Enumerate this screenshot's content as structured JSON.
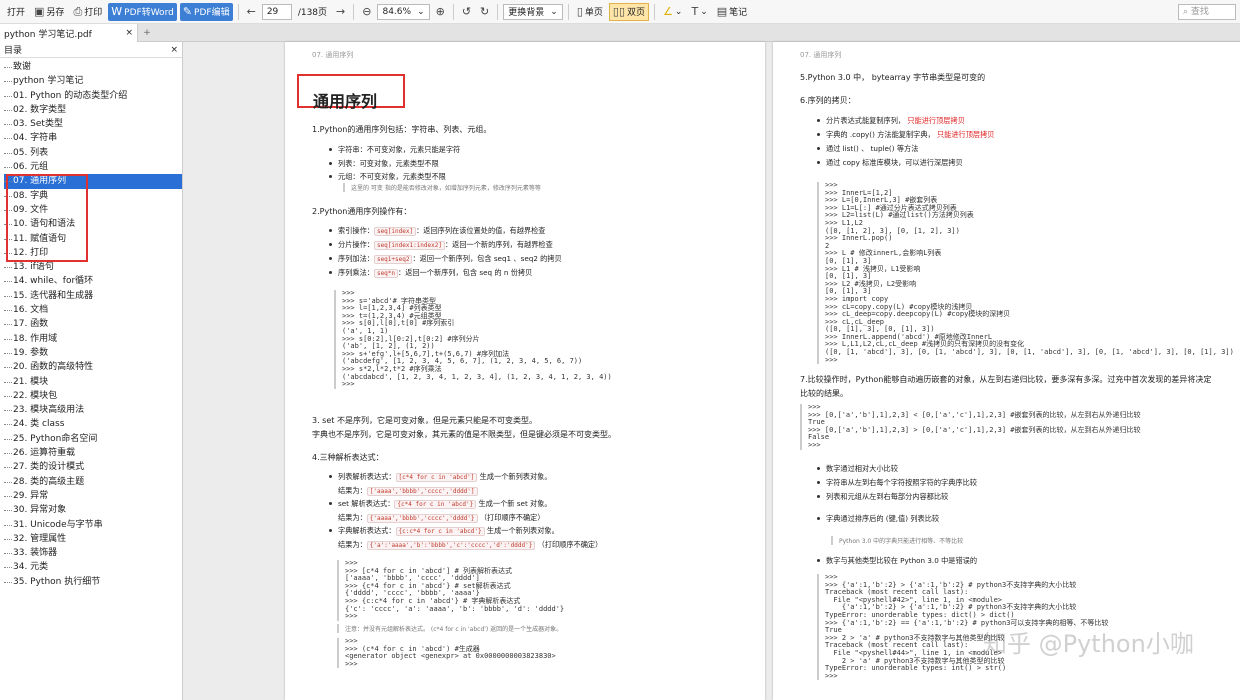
{
  "toolbar": {
    "open": "打开",
    "save_as": "另存",
    "print": "打印",
    "pdf_to_word": "PDF转Word",
    "pdf_edit": "PDF编辑",
    "page_current": "29",
    "page_total": "/138页",
    "zoom": "84.6%",
    "bg": "更换背景",
    "single": "单页",
    "double": "双页",
    "highlight": "∠",
    "text": "T",
    "notes": "笔记",
    "search_placeholder": "查找"
  },
  "tab": {
    "label": "python 学习笔记.pdf",
    "close": "×",
    "add": "+"
  },
  "sidebar": {
    "title": "目录",
    "close": "×",
    "items": [
      "致谢",
      "python 学习笔记",
      "01. Python 的动态类型介绍",
      "02. 数字类型",
      "03. Set类型",
      "04. 字符串",
      "05. 列表",
      "06. 元组",
      "07. 通用序列",
      "08. 字典",
      "09. 文件",
      "10. 语句和语法",
      "11. 赋值语句",
      "12. 打印",
      "13. if语句",
      "14. while、for循环",
      "15. 迭代器和生成器",
      "16. 文档",
      "17. 函数",
      "18. 作用域",
      "19. 参数",
      "20. 函数的高级特性",
      "21. 模块",
      "22. 模块包",
      "23. 模块高级用法",
      "24. 类 class",
      "25. Python命名空间",
      "26. 运算符重载",
      "27. 类的设计模式",
      "28. 类的高级主题",
      "29. 异常",
      "30. 异常对象",
      "31. Unicode与字节串",
      "32. 管理属性",
      "33. 装饰器",
      "34. 元类",
      "35. Python 执行细节"
    ],
    "selected_index": 8
  },
  "page1": {
    "header": "07. 通用序列",
    "title": "通用序列",
    "s1": "1.Python的通用序列包括：字符串、列表、元组。",
    "s1_items": [
      "字符串：不可变对象，元素只能是字符",
      "列表：可变对象，元素类型不限",
      "元组：不可变对象，元素类型不限"
    ],
    "s1_note": "这里的  可变  指的是能否修改对象，如增加序列元素，修改序列元素等等",
    "s2": "2.Python通用序列操作有：",
    "s2_items": [
      {
        "name": "索引操作：",
        "chip": "seq[index]",
        "desc": "：返回序列在该位置处的值，有越界检查"
      },
      {
        "name": "分片操作：",
        "chip": "seq[index1:index2]",
        "desc": "：返回一个新的序列，有越界检查"
      },
      {
        "name": "序列加法：",
        "chip": "seq1+seq2",
        "desc": "：返回一个新序列，包含 seq1 、seq2 的拷贝"
      },
      {
        "name": "序列乘法：",
        "chip": "seq*n",
        "desc": "：返回一个新序列，包含 seq 的 n 份拷贝"
      }
    ],
    "code1": ">>>\n>>> s='abcd'# 字符串类型\n>>> l=[1,2,3,4] #列表类型\n>>> t=(1,2,3,4) #元组类型\n>>> s[0],l[0],t[0] #序列索引\n('a', 1, 1)\n>>> s[0:2],l[0:2],t[0:2] #序列分片\n('ab', [1, 2], (1, 2))\n>>> s+'efg',l+[5,6,7],t+(5,6,7) #序列加法\n('abcdefg', [1, 2, 3, 4, 5, 6, 7], (1, 2, 3, 4, 5, 6, 7))\n>>> s*2,l*2,t*2 #序列乘法\n('abcdabcd', [1, 2, 3, 4, 1, 2, 3, 4], (1, 2, 3, 4, 1, 2, 3, 4))\n>>>",
    "s3a": "3.  set  不是序列，它是可变对象，但是元素只能是不可变类型。",
    "s3b": "字典也不是序列，它是可变对象，其元素的值是不限类型，但是键必须是不可变类型。",
    "s4": "4.三种解析表达式：",
    "s4_items": [
      {
        "a": "列表解析表达式：",
        "chip": "[c*4 for c in 'abcd']",
        "b": "生成一个新列表对象。",
        "r": "结果为：",
        "rchip": "['aaaa','bbbb','cccc','dddd']",
        "rb": ""
      },
      {
        "a": "set 解析表达式：",
        "chip": "{c*4 for c in 'abcd'}",
        "b": "生成一个新 set 对象。",
        "r": "结果为：",
        "rchip": "{'aaaa','bbbb','cccc','dddd'}",
        "rb": "（打印顺序不确定）"
      },
      {
        "a": "字典解析表达式：",
        "chip": "{c:c*4 for c in 'abcd'}",
        "b": "生成一个新列表对象。",
        "r": "结果为：",
        "rchip": "{'a':'aaaa','b':'bbbb','c':'cccc','d':'dddd'}",
        "rb": "（打印顺序不确定）"
      }
    ],
    "code2": ">>>\n>>> [c*4 for c in 'abcd'] # 列表解析表达式\n['aaaa', 'bbbb', 'cccc', 'dddd']\n>>> {c*4 for c in 'abcd'} # set解析表达式\n{'dddd', 'cccc', 'bbbb', 'aaaa'}\n>>> {c:c*4 for c in 'abcd'} # 字典解析表达式\n{'c': 'cccc', 'a': 'aaaa', 'b': 'bbbb', 'd': 'dddd'}\n>>>",
    "note2": "注意：并没有元组解析表达式。 (c*4 for c in 'abcd') 返回的是一个生成器对象。",
    "code3": ">>>\n>>> (c*4 for c in 'abcd') #生成器\n<generator object <genexpr> at 0x0000000003823830>\n>>>"
  },
  "page2": {
    "header": "07. 通用序列",
    "s5": "5.Python 3.0 中， bytearray 字节串类型是可变的",
    "s6": "6.序列的拷贝：",
    "s6_items": [
      {
        "t": "分片表达式能复制序列，",
        "r": "只能进行顶层拷贝"
      },
      {
        "t": "字典的 .copy() 方法能复制字典，",
        "r": "只能进行顶层拷贝"
      },
      {
        "t": "通过 list() 、 tuple() 等方法",
        "r": ""
      },
      {
        "t": "通过 copy 标准库模块，可以进行深层拷贝",
        "r": ""
      }
    ],
    "code1": ">>>\n>>> InnerL=[1,2]\n>>> L=[0,InnerL,3] #嵌套列表\n>>> L1=L[:] #通过分片表达式拷贝列表\n>>> L2=list(L) #通过list()方法拷贝列表\n>>> L1,L2\n([0, [1, 2], 3], [0, [1, 2], 3])\n>>> InnerL.pop()\n2\n>>> L # 修改innerL,会影响L列表\n[0, [1], 3]\n>>> L1 # 浅拷贝，L1受影响\n[0, [1], 3]\n>>> L2 #浅拷贝，L2受影响\n[0, [1], 3]\n>>> import copy\n>>> cL=copy.copy(L) #copy模块的浅拷贝\n>>> cL_deep=copy.deepcopy(L) #copy模块的深拷贝\n>>> cL,cL_deep\n([0, [1], 3], [0, [1], 3])\n>>> InnerL.append('abcd') #原地修改InnerL\n>>> L,L1,L2,cL,cL_deep #浅拷贝的只有深拷贝的没有变化\n([0, [1, 'abcd'], 3], [0, [1, 'abcd'], 3], [0, [1, 'abcd'], 3], [0, [1, 'abcd'], 3], [0, [1], 3])\n>>>",
    "s7a": "7.比较操作时，Python能够自动遍历嵌套的对象，从左到右递归比较，要多深有多深。过充中首次发现的差异将决定",
    "s7b": "比较的结果。",
    "code2": ">>>\n>>> [0,['a','b'],1],2,3] < [0,['a','c'],1],2,3] #嵌套列表的比较，从左到右从外递归比较\nTrue\n>>> [0,['a','b'],1],2,3] > [0,['a','c'],1],2,3] #嵌套列表的比较，从左到右从外递归比较\nFalse\n>>>",
    "s7_items": [
      "数字通过相对大小比较",
      "字符串从左到右每个字符按照字符的字典序比较",
      "列表和元组从左到右每部分内容都比较"
    ],
    "s7_dict": "字典通过排序后的 (键,值) 列表比较",
    "s7_note": "Python 3.0 中的字典只能进行相等、不等比较",
    "s7_last": "数字与其他类型比较在 Python 3.0 中是错误的",
    "code3": ">>>\n>>> {'a':1,'b':2} > {'a':1,'b':2} # python3不支持字典的大小比较\nTraceback (most recent call last):\n  File \"<pyshell#42>\", line 1, in <module>\n    {'a':1,'b':2} > {'a':1,'b':2} # python3不支持字典的大小比较\nTypeError: unorderable types: dict() > dict()\n>>> {'a':1,'b':2} == {'a':1,'b':2} # python3可以支持字典的相等、不等比较\nTrue\n>>> 2 > 'a' # python3不支持数字与其他类型的比较\nTraceback (most recent call last):\n  File \"<pyshell#44>\", line 1, in <module>\n    2 > 'a' # python3不支持数字与其他类型的比较\nTypeError: unorderable types: int() > str()\n>>>",
    "watermark": "知乎 @Python小咖"
  }
}
